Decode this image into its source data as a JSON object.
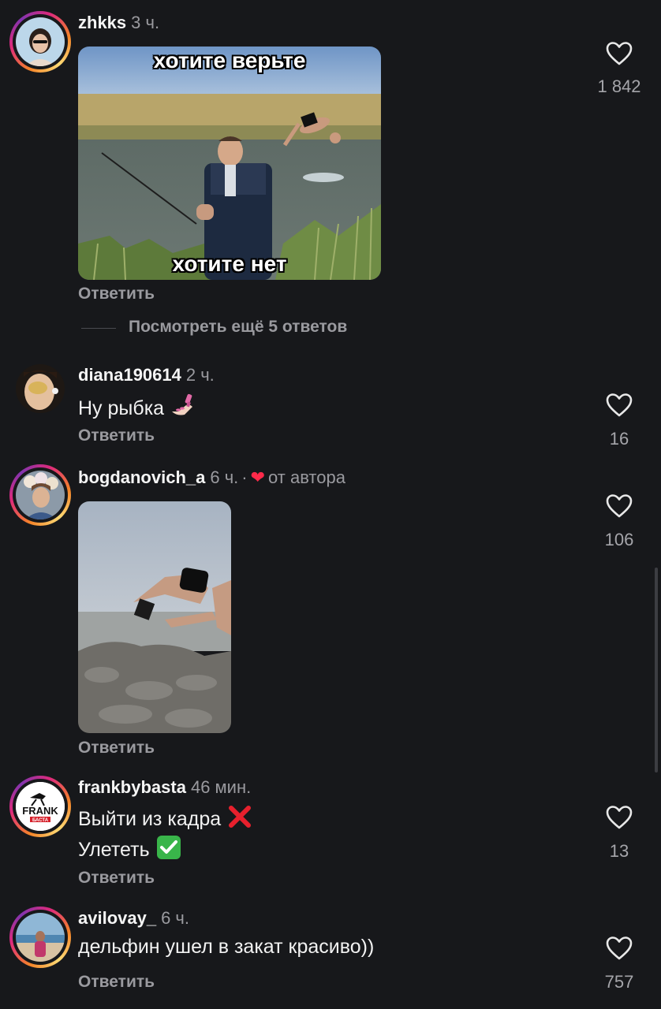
{
  "comments": [
    {
      "username": "zhkks",
      "time": "3 ч.",
      "meme_top_caption": "хотите верьте",
      "meme_bottom_caption": "хотите нет",
      "reply_label": "Ответить",
      "likes": "1 842"
    },
    {
      "username": "diana190614",
      "time": "2 ч.",
      "text": "Ну рыбка",
      "emoji": "nail-polish",
      "reply_label": "Ответить",
      "likes": "16"
    },
    {
      "username": "bogdanovich_a",
      "time": "6 ч.",
      "separator": "·",
      "author_badge": "от автора",
      "reply_label": "Ответить",
      "likes": "106"
    },
    {
      "username": "frankbybasta",
      "time": "46 мин.",
      "line1": "Выйти из кадра",
      "line1_emoji": "cross-mark",
      "line2": "Улететь",
      "line2_emoji": "check-mark-button",
      "reply_label": "Ответить",
      "likes": "13",
      "avatar_text": "FRANK",
      "avatar_subtext": "БАСТА"
    },
    {
      "username": "avilovay_",
      "time": "6 ч.",
      "text": "дельфин ушел в закат красиво))",
      "reply_label": "Ответить",
      "likes": "757"
    }
  ],
  "thread": {
    "view_more_label": "Посмотреть ещё 5 ответов"
  },
  "colors": {
    "background": "#17181b",
    "muted_text": "#9a9a9f",
    "heart_red": "#ff2a4a"
  },
  "icons": {
    "like": "heart-outline-icon",
    "author_like": "heart-filled-icon"
  }
}
